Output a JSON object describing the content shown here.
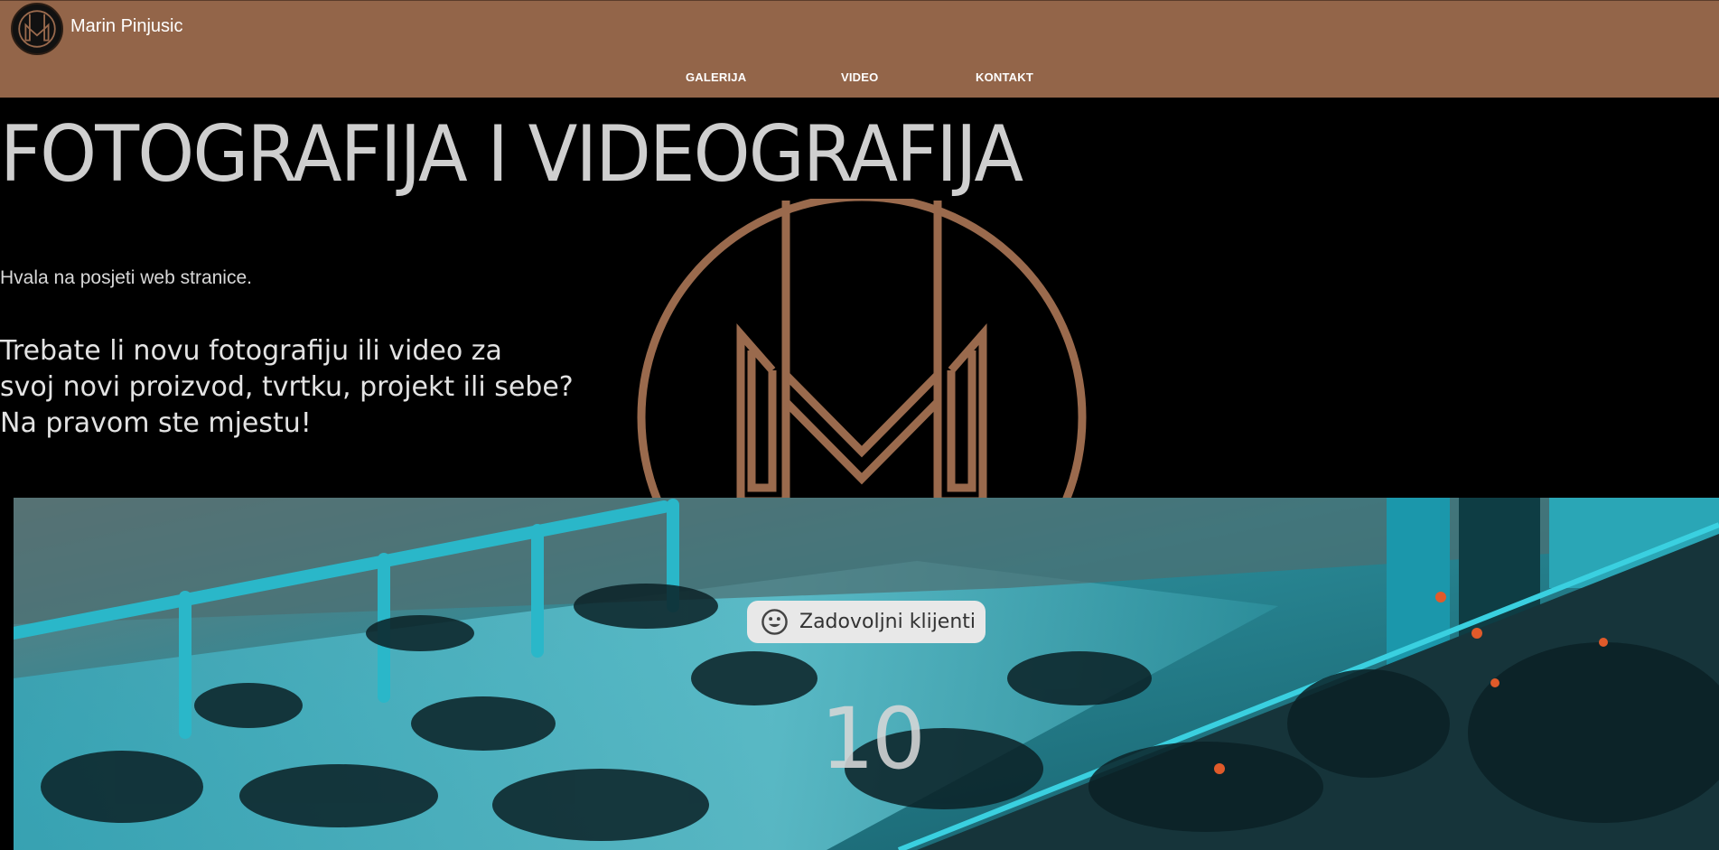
{
  "header": {
    "site_name": "Marin Pinjusic",
    "logo_icon": "mp-monogram-icon",
    "nav": [
      {
        "label": "GALERIJA"
      },
      {
        "label": "VIDEO"
      },
      {
        "label": "KONTAKT"
      }
    ]
  },
  "hero": {
    "title": "FOTOGRAFIJA I VIDEOGRAFIJA",
    "welcome": "Hvala na posjeti web stranice.",
    "pitch_lines": [
      "Trebate li novu fotografiju ili video za",
      "svoj novi proizvod, tvrtku, projekt ili sebe?",
      "Na pravom ste mjestu!"
    ],
    "watermark_icon": "mp-monogram-icon"
  },
  "stats": {
    "badge_icon": "smiley-face-icon",
    "badge_label": "Zadovoljni klijenti",
    "count": "10"
  },
  "colors": {
    "header_bg": "#936549",
    "brand_brown": "#9a6a4d",
    "page_bg": "#000000",
    "title_text": "#cfcfcf"
  }
}
